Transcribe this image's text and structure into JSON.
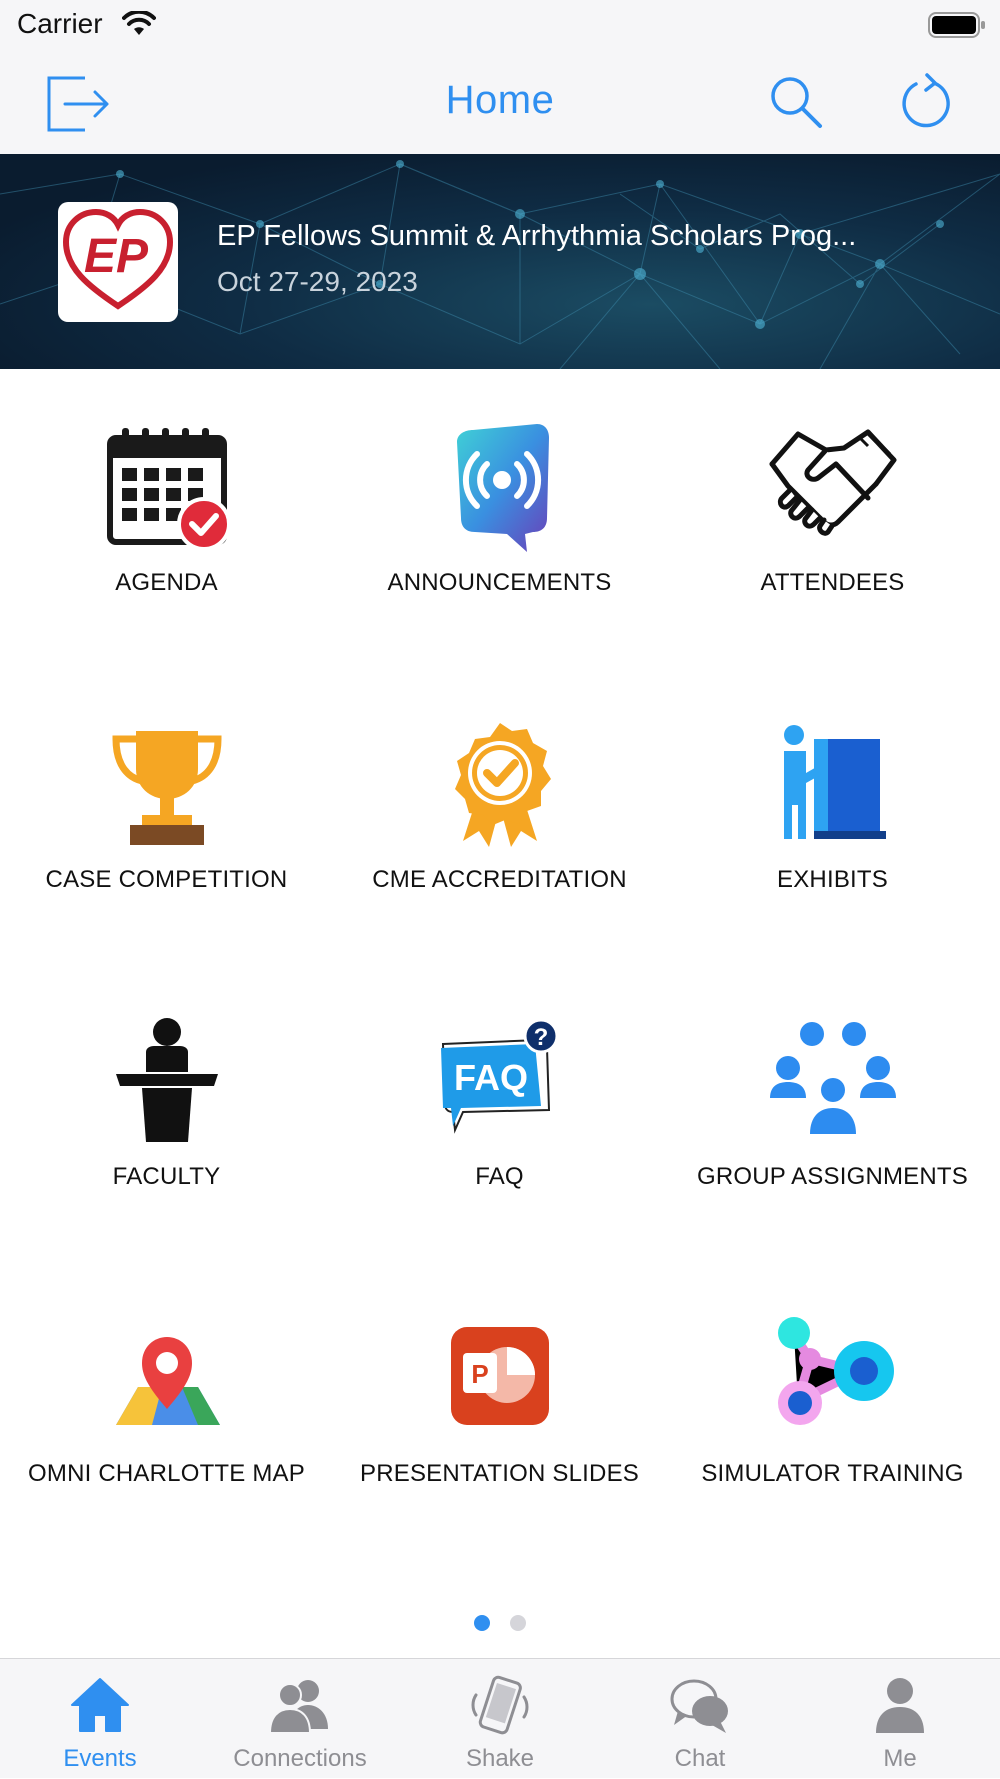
{
  "status_bar": {
    "carrier": "Carrier"
  },
  "nav": {
    "title": "Home",
    "accent_color": "#2f8ff0"
  },
  "event": {
    "logo_text": "EP",
    "title": "EP Fellows Summit & Arrhythmia Scholars Prog...",
    "date": "Oct 27-29, 2023"
  },
  "menu": {
    "items": [
      {
        "label": "AGENDA",
        "icon": "calendar-check-icon"
      },
      {
        "label": "ANNOUNCEMENTS",
        "icon": "broadcast-icon"
      },
      {
        "label": "ATTENDEES",
        "icon": "handshake-icon"
      },
      {
        "label": "CASE COMPETITION",
        "icon": "trophy-icon"
      },
      {
        "label": "CME ACCREDITATION",
        "icon": "award-badge-icon"
      },
      {
        "label": "EXHIBITS",
        "icon": "exhibit-booth-icon"
      },
      {
        "label": "FACULTY",
        "icon": "podium-speaker-icon"
      },
      {
        "label": "FAQ",
        "icon": "faq-icon"
      },
      {
        "label": "GROUP ASSIGNMENTS",
        "icon": "group-icon"
      },
      {
        "label": "OMNI CHARLOTTE MAP",
        "icon": "map-pin-icon"
      },
      {
        "label": "PRESENTATION SLIDES",
        "icon": "powerpoint-icon"
      },
      {
        "label": "SIMULATOR TRAINING",
        "icon": "molecule-network-icon"
      }
    ]
  },
  "pagination": {
    "pages": 2,
    "current": 1
  },
  "tabs": [
    {
      "label": "Events",
      "icon": "house-icon",
      "active": true
    },
    {
      "label": "Connections",
      "icon": "people-icon",
      "active": false
    },
    {
      "label": "Shake",
      "icon": "shake-phone-icon",
      "active": false
    },
    {
      "label": "Chat",
      "icon": "chat-bubbles-icon",
      "active": false
    },
    {
      "label": "Me",
      "icon": "person-icon",
      "active": false
    }
  ]
}
